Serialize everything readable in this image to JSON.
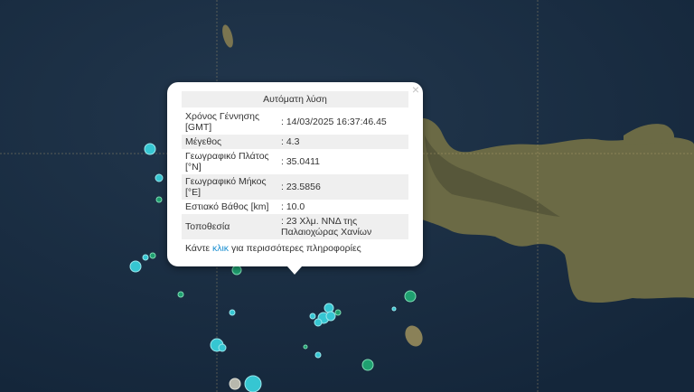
{
  "colors": {
    "sea": "#1b2f45",
    "land": "#6e6a45",
    "cyan_marker": "#36c6d2",
    "green_marker": "#1fa070",
    "grey_marker": "#b8b8ad",
    "link": "#1a8fd1"
  },
  "popup": {
    "close_icon": "×",
    "title": "Αυτόματη λύση",
    "rows": [
      {
        "key": "Χρόνος Γέννησης [GMT]",
        "value": ": 14/03/2025 16:37:46.45"
      },
      {
        "key": "Μέγεθος",
        "value": ": 4.3"
      },
      {
        "key": "Γεωγραφικό Πλάτος [°N]",
        "value": ": 35.0411"
      },
      {
        "key": "Γεωγραφικό Μήκος [°E]",
        "value": ": 23.5856"
      },
      {
        "key": "Εστιακό Βάθος [km]",
        "value": ": 10.0"
      },
      {
        "key": "Τοποθεσία",
        "value": ": 23 Χλμ. ΝΝΔ της Παλαιοχώρας Χανίων"
      }
    ],
    "more_before": "Κάντε ",
    "more_link": "κλικ",
    "more_after": " για περισσότερες πληροφορίες"
  }
}
